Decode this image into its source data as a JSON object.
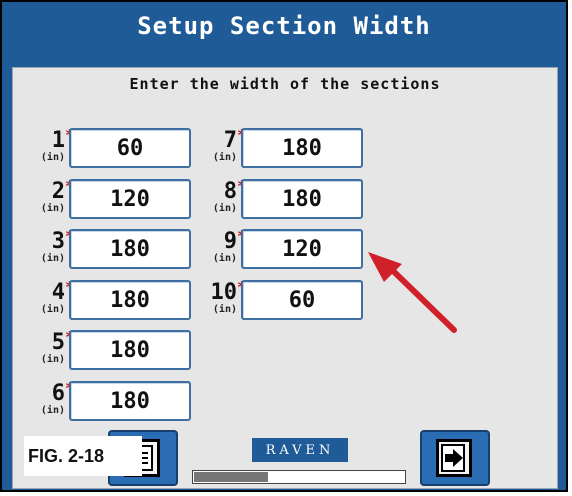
{
  "title": "Setup Section Width",
  "instruction": "Enter the width of the sections",
  "sections": [
    {
      "num": "1",
      "unit": "(in)",
      "value": "60"
    },
    {
      "num": "2",
      "unit": "(in)",
      "value": "120"
    },
    {
      "num": "3",
      "unit": "(in)",
      "value": "180"
    },
    {
      "num": "4",
      "unit": "(in)",
      "value": "180"
    },
    {
      "num": "5",
      "unit": "(in)",
      "value": "180"
    },
    {
      "num": "6",
      "unit": "(in)",
      "value": "180"
    },
    {
      "num": "7",
      "unit": "(in)",
      "value": "180"
    },
    {
      "num": "8",
      "unit": "(in)",
      "value": "180"
    },
    {
      "num": "9",
      "unit": "(in)",
      "value": "120"
    },
    {
      "num": "10",
      "unit": "(in)",
      "value": "60"
    }
  ],
  "required_marker": "*",
  "brand": "RAVEN",
  "figure_label": "FIG. 2-18",
  "progress_fraction": 0.35,
  "colors": {
    "background": "#1f5b96",
    "panel": "#e6e6e6",
    "required": "#d01010",
    "arrow": "#d0202a"
  },
  "icons": {
    "back": "document-icon",
    "next": "next-page-icon"
  }
}
